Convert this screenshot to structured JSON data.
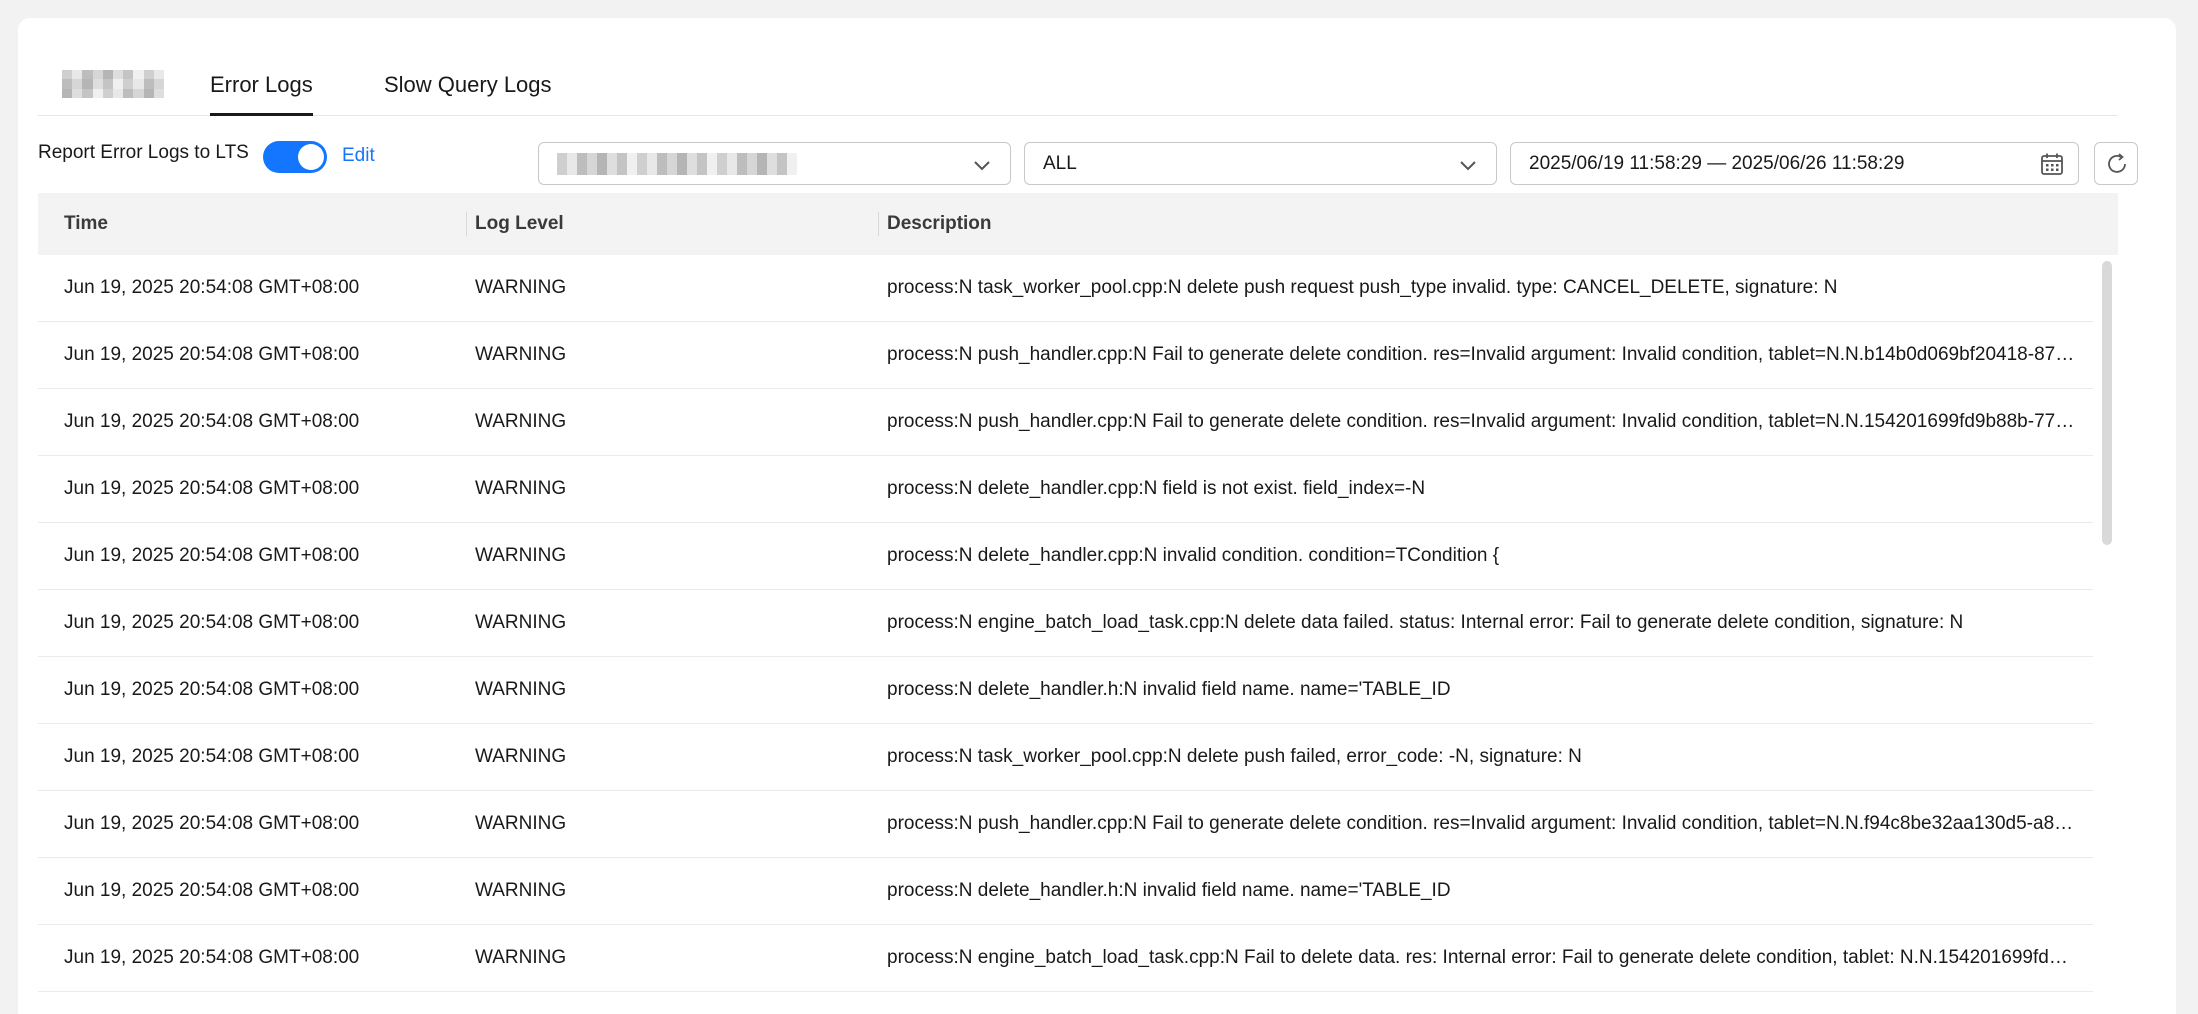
{
  "tabs": {
    "items": [
      {
        "label": "Error Logs",
        "active": true
      },
      {
        "label": "Slow Query Logs",
        "active": false
      }
    ]
  },
  "toolbar": {
    "report_label": "Report Error Logs to LTS",
    "toggle_on": true,
    "edit_label": "Edit",
    "level_select_value": "ALL",
    "date_range": "2025/06/19 11:58:29 — 2025/06/26 11:58:29",
    "accent_color": "#1476ff"
  },
  "table": {
    "columns": [
      "Time",
      "Log Level",
      "Description"
    ],
    "rows": [
      {
        "time": "Jun 19, 2025 20:54:08 GMT+08:00",
        "level": "WARNING",
        "desc": "process:N task_worker_pool.cpp:N delete push request push_type invalid. type: CANCEL_DELETE, signature: N"
      },
      {
        "time": "Jun 19, 2025 20:54:08 GMT+08:00",
        "level": "WARNING",
        "desc": "process:N push_handler.cpp:N Fail to generate delete condition. res=Invalid argument: Invalid condition, tablet=N.N.b14b0d069bf20418-87…"
      },
      {
        "time": "Jun 19, 2025 20:54:08 GMT+08:00",
        "level": "WARNING",
        "desc": "process:N push_handler.cpp:N Fail to generate delete condition. res=Invalid argument: Invalid condition, tablet=N.N.154201699fd9b88b-77…"
      },
      {
        "time": "Jun 19, 2025 20:54:08 GMT+08:00",
        "level": "WARNING",
        "desc": "process:N delete_handler.cpp:N field is not exist. field_index=-N"
      },
      {
        "time": "Jun 19, 2025 20:54:08 GMT+08:00",
        "level": "WARNING",
        "desc": "process:N delete_handler.cpp:N invalid condition. condition=TCondition {"
      },
      {
        "time": "Jun 19, 2025 20:54:08 GMT+08:00",
        "level": "WARNING",
        "desc": "process:N engine_batch_load_task.cpp:N delete data failed. status: Internal error: Fail to generate delete condition, signature: N"
      },
      {
        "time": "Jun 19, 2025 20:54:08 GMT+08:00",
        "level": "WARNING",
        "desc": "process:N delete_handler.h:N invalid field name. name='TABLE_ID"
      },
      {
        "time": "Jun 19, 2025 20:54:08 GMT+08:00",
        "level": "WARNING",
        "desc": "process:N task_worker_pool.cpp:N delete push failed, error_code: -N, signature: N"
      },
      {
        "time": "Jun 19, 2025 20:54:08 GMT+08:00",
        "level": "WARNING",
        "desc": "process:N push_handler.cpp:N Fail to generate delete condition. res=Invalid argument: Invalid condition, tablet=N.N.f94c8be32aa130d5-a8…"
      },
      {
        "time": "Jun 19, 2025 20:54:08 GMT+08:00",
        "level": "WARNING",
        "desc": "process:N delete_handler.h:N invalid field name. name='TABLE_ID"
      },
      {
        "time": "Jun 19, 2025 20:54:08 GMT+08:00",
        "level": "WARNING",
        "desc": "process:N engine_batch_load_task.cpp:N Fail to delete data. res: Internal error: Fail to generate delete condition, tablet: N.N.154201699fd…"
      }
    ]
  }
}
